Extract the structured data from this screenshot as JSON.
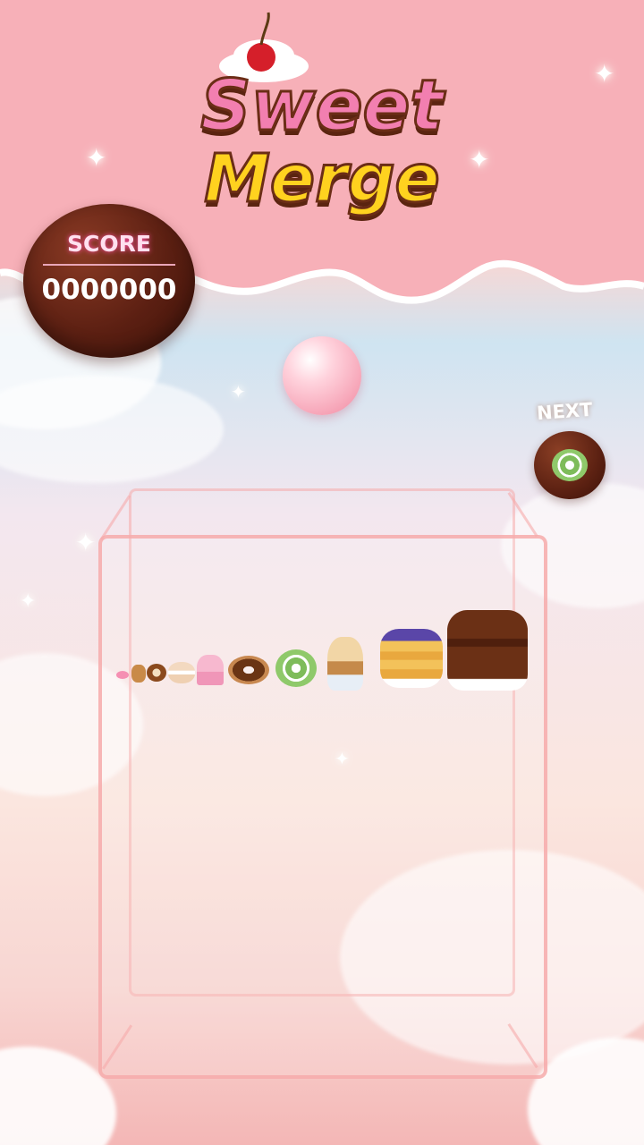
{
  "logo": {
    "line1": "Sweet",
    "line2": "Merge"
  },
  "score": {
    "label": "SCORE",
    "value": "0000000"
  },
  "next": {
    "label": "NEXT",
    "item": "swiss-roll-icon"
  },
  "current_piece": "pink-bubble-icon",
  "foods": [
    "candy-icon",
    "gingerbread-icon",
    "pretzel-icon",
    "macaron-icon",
    "cupcake-icon",
    "donut-icon",
    "swiss-roll-icon",
    "sundae-icon",
    "pancakes-icon",
    "chocolate-cake-icon"
  ],
  "colors": {
    "accent": "#f27fb0",
    "brand": "#ffd21f",
    "chocolate": "#5b1f12",
    "box": "#f6aaaa"
  }
}
